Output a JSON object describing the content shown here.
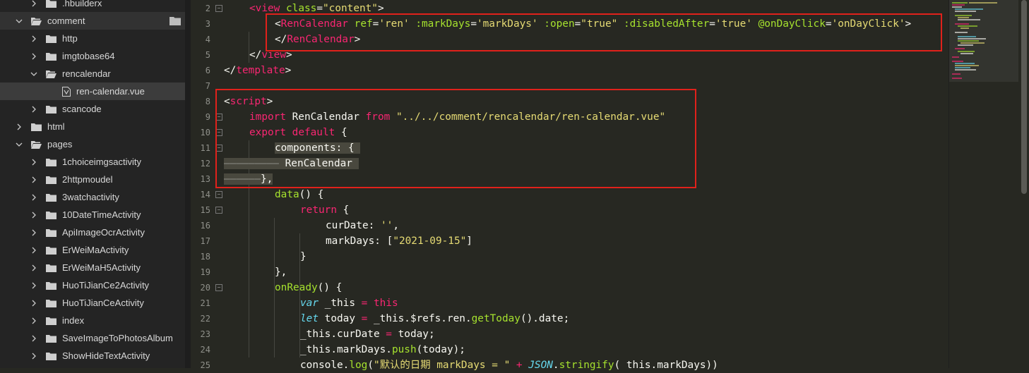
{
  "sidebar": {
    "items": [
      {
        "label": ".hbuilderx",
        "level": 1,
        "expanded": false,
        "type": "folder"
      },
      {
        "label": "comment",
        "level": 0,
        "expanded": true,
        "type": "folder"
      },
      {
        "label": "http",
        "level": 1,
        "expanded": false,
        "type": "folder"
      },
      {
        "label": "imgtobase64",
        "level": 1,
        "expanded": false,
        "type": "folder"
      },
      {
        "label": "rencalendar",
        "level": 1,
        "expanded": true,
        "type": "folder"
      },
      {
        "label": "ren-calendar.vue",
        "level": 2,
        "type": "vue-file"
      },
      {
        "label": "scancode",
        "level": 1,
        "expanded": false,
        "type": "folder"
      },
      {
        "label": "html",
        "level": 0,
        "expanded": false,
        "type": "folder"
      },
      {
        "label": "pages",
        "level": 0,
        "expanded": true,
        "type": "folder"
      },
      {
        "label": "1choiceimgsactivity",
        "level": 1,
        "expanded": false,
        "type": "folder"
      },
      {
        "label": "2httpmoudel",
        "level": 1,
        "expanded": false,
        "type": "folder"
      },
      {
        "label": "3watchactivity",
        "level": 1,
        "expanded": false,
        "type": "folder"
      },
      {
        "label": "10DateTimeActivity",
        "level": 1,
        "expanded": false,
        "type": "folder"
      },
      {
        "label": "ApiImageOcrActivity",
        "level": 1,
        "expanded": false,
        "type": "folder"
      },
      {
        "label": "ErWeiMaActivity",
        "level": 1,
        "expanded": false,
        "type": "folder"
      },
      {
        "label": "ErWeiMaH5Activity",
        "level": 1,
        "expanded": false,
        "type": "folder"
      },
      {
        "label": "HuoTiJianCe2Activity",
        "level": 1,
        "expanded": false,
        "type": "folder"
      },
      {
        "label": "HuoTiJianCeActivity",
        "level": 1,
        "expanded": false,
        "type": "folder"
      },
      {
        "label": "index",
        "level": 1,
        "expanded": false,
        "type": "folder"
      },
      {
        "label": "SaveImageToPhotosAlbum",
        "level": 1,
        "expanded": false,
        "type": "folder"
      },
      {
        "label": "ShowHideTextActivity",
        "level": 1,
        "expanded": false,
        "type": "folder"
      }
    ]
  },
  "editor": {
    "line_numbers": [
      "2",
      "3",
      "4",
      "5",
      "6",
      "7",
      "8",
      "9",
      "10",
      "11",
      "12",
      "13",
      "14",
      "15",
      "16",
      "17",
      "18",
      "19",
      "20",
      "21",
      "22",
      "23",
      "24",
      "25"
    ],
    "lines": [
      {
        "indent": 1,
        "tokens": [
          [
            "tg",
            "<"
          ],
          [
            "tg",
            "view"
          ],
          [
            "pl",
            " "
          ],
          [
            "at",
            "class"
          ],
          [
            "pl",
            "="
          ],
          [
            "st",
            "\"content\""
          ],
          [
            "pl",
            ">"
          ]
        ]
      },
      {
        "indent": 2,
        "tokens": [
          [
            "pl",
            "<"
          ],
          [
            "tg",
            "RenCalendar"
          ],
          [
            "pl",
            " "
          ],
          [
            "at",
            "ref"
          ],
          [
            "pl",
            "="
          ],
          [
            "st",
            "'ren'"
          ],
          [
            "pl",
            " "
          ],
          [
            "at",
            ":markDays"
          ],
          [
            "pl",
            "="
          ],
          [
            "st",
            "'markDays'"
          ],
          [
            "pl",
            " "
          ],
          [
            "at",
            ":open"
          ],
          [
            "pl",
            "="
          ],
          [
            "st",
            "\"true\""
          ],
          [
            "pl",
            " "
          ],
          [
            "at",
            ":disabledAfter"
          ],
          [
            "pl",
            "="
          ],
          [
            "st",
            "'true'"
          ],
          [
            "pl",
            " "
          ],
          [
            "at",
            "@onDayClick"
          ],
          [
            "pl",
            "="
          ],
          [
            "st",
            "'onDayClick'"
          ],
          [
            "pl",
            ">"
          ]
        ]
      },
      {
        "indent": 2,
        "tokens": [
          [
            "pl",
            "</"
          ],
          [
            "tg",
            "RenCalendar"
          ],
          [
            "pl",
            ">"
          ]
        ]
      },
      {
        "indent": 1,
        "tokens": [
          [
            "pl",
            "</"
          ],
          [
            "tg",
            "view"
          ],
          [
            "pl",
            ">"
          ]
        ]
      },
      {
        "indent": 0,
        "tokens": [
          [
            "pl",
            "</"
          ],
          [
            "tg",
            "template"
          ],
          [
            "pl",
            ">"
          ]
        ]
      },
      {
        "indent": 0,
        "tokens": []
      },
      {
        "indent": 0,
        "tokens": [
          [
            "pl",
            "<"
          ],
          [
            "tg",
            "script"
          ],
          [
            "pl",
            ">"
          ]
        ]
      },
      {
        "indent": 1,
        "tokens": [
          [
            "kw",
            "import"
          ],
          [
            "pl",
            " RenCalendar "
          ],
          [
            "kw",
            "from"
          ],
          [
            "pl",
            " "
          ],
          [
            "st",
            "\"../../comment/rencalendar/ren-calendar.vue\""
          ]
        ]
      },
      {
        "indent": 1,
        "tokens": [
          [
            "kw",
            "export"
          ],
          [
            "pl",
            " "
          ],
          [
            "kw",
            "default"
          ],
          [
            "pl",
            " {"
          ]
        ]
      },
      {
        "indent": 2,
        "tokens": [
          [
            "sel",
            "components: { "
          ]
        ]
      },
      {
        "indent": 0,
        "tokens": [
          [
            "ws",
            "—————————"
          ],
          [
            "sel",
            " RenCalendar "
          ]
        ]
      },
      {
        "indent": 0,
        "tokens": [
          [
            "ws",
            "——————"
          ],
          [
            "sel",
            "},"
          ]
        ]
      },
      {
        "indent": 2,
        "tokens": [
          [
            "fn",
            "data"
          ],
          [
            "pl",
            "() {"
          ]
        ]
      },
      {
        "indent": 3,
        "tokens": [
          [
            "kw",
            "return"
          ],
          [
            "pl",
            " {"
          ]
        ]
      },
      {
        "indent": 4,
        "tokens": [
          [
            "pl",
            "curDate: "
          ],
          [
            "st",
            "''"
          ],
          [
            "pl",
            ","
          ]
        ]
      },
      {
        "indent": 4,
        "tokens": [
          [
            "pl",
            "markDays: ["
          ],
          [
            "st",
            "\"2021-09-15\""
          ],
          [
            "pl",
            "]"
          ]
        ]
      },
      {
        "indent": 3,
        "tokens": [
          [
            "pl",
            "}"
          ]
        ]
      },
      {
        "indent": 2,
        "tokens": [
          [
            "pl",
            "},"
          ]
        ]
      },
      {
        "indent": 2,
        "tokens": [
          [
            "fn",
            "onReady"
          ],
          [
            "pl",
            "() {"
          ]
        ]
      },
      {
        "indent": 3,
        "tokens": [
          [
            "it",
            "var"
          ],
          [
            "pl",
            " _this "
          ],
          [
            "kw",
            "="
          ],
          [
            "pl",
            " "
          ],
          [
            "kw",
            "this"
          ]
        ]
      },
      {
        "indent": 3,
        "tokens": [
          [
            "it",
            "let"
          ],
          [
            "pl",
            " today "
          ],
          [
            "kw",
            "="
          ],
          [
            "pl",
            " _this.$refs.ren."
          ],
          [
            "fn",
            "getToday"
          ],
          [
            "pl",
            "().date;"
          ]
        ]
      },
      {
        "indent": 3,
        "tokens": [
          [
            "pl",
            "_this.curDate "
          ],
          [
            "kw",
            "="
          ],
          [
            "pl",
            " today;"
          ]
        ]
      },
      {
        "indent": 3,
        "tokens": [
          [
            "pl",
            "_this.markDays."
          ],
          [
            "fn",
            "push"
          ],
          [
            "pl",
            "(today);"
          ]
        ]
      },
      {
        "indent": 3,
        "tokens": [
          [
            "pl",
            "console."
          ],
          [
            "fn",
            "log"
          ],
          [
            "pl",
            "("
          ],
          [
            "st",
            "\"默认的日期 markDays = \""
          ],
          [
            "pl",
            " "
          ],
          [
            "kw",
            "+"
          ],
          [
            "pl",
            " "
          ],
          [
            "it",
            "JSON"
          ],
          [
            "pl",
            "."
          ],
          [
            "fn",
            "stringify"
          ],
          [
            "pl",
            "( this.markDays))"
          ]
        ]
      }
    ]
  },
  "colors": {
    "editor_bg": "#272822",
    "sidebar_bg": "#242424",
    "highlight_box": "#e0211b"
  }
}
